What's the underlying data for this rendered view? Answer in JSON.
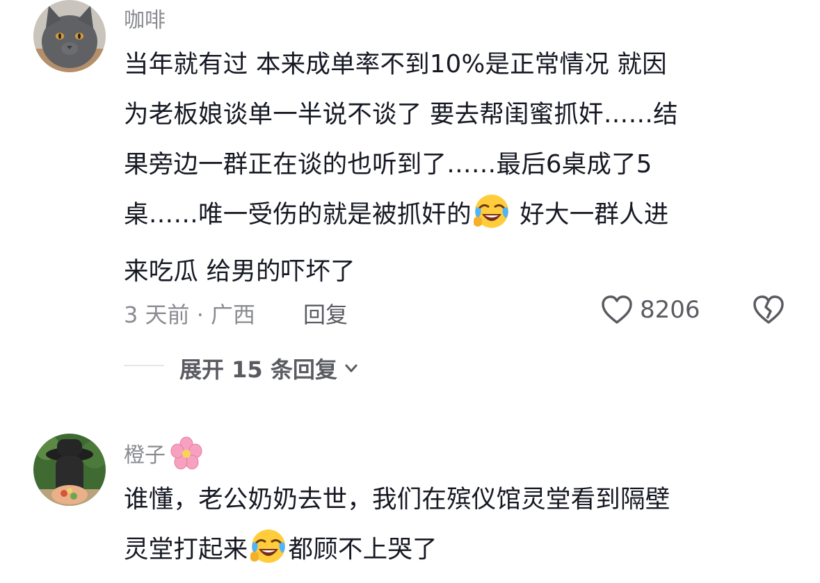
{
  "comments": [
    {
      "username": "咖啡",
      "avatar_icon": "gray-cat-avatar",
      "lines": [
        "当年就有过 本来成单率不到10%是正常情况 就因",
        "为老板娘谈单一半说不谈了 要去帮闺蜜抓奸……结",
        "果旁边一群正在谈的也听到了……最后6桌成了5"
      ],
      "line4_before": "桌……唯一受伤的就是被抓奸的",
      "line4_emoji": "laughing-tears-emoji",
      "line4_after": " 好大一群人进",
      "line5": "来吃瓜 给男的吓坏了",
      "time_location": "3 天前 · 广西",
      "reply_label": "回复",
      "like_icon": "heart-outline-icon",
      "like_count": "8206",
      "dislike_icon": "broken-heart-icon",
      "expand_label": "展开 15 条回复",
      "expand_icon": "chevron-down-icon"
    },
    {
      "username": "橙子",
      "username_emoji": "cherry-blossom-emoji",
      "avatar_icon": "person-hat-avatar",
      "line1": "谁懂，老公奶奶去世，我们在殡仪馆灵堂看到隔壁",
      "line2_before": "灵堂打起来",
      "line2_emoji": "laughing-tears-emoji",
      "line2_after": "都顾不上哭了"
    }
  ],
  "colors": {
    "text_primary": "#161823",
    "text_secondary": "#8a8b91",
    "text_action": "#5a5b61",
    "divider": "#e6e6e9"
  }
}
